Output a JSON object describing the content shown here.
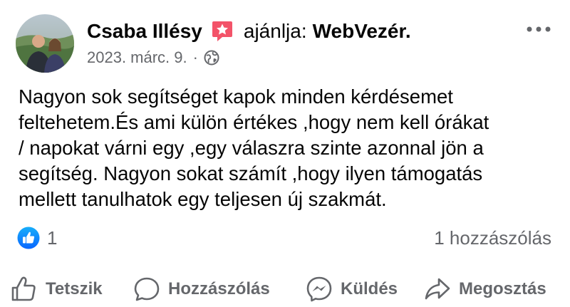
{
  "post": {
    "author": "Csaba Illésy",
    "recommends_text": "ajánlja:",
    "page_name": "WebVezér.",
    "date": "2023. márc. 9.",
    "separator": "·",
    "audience_icon": "globe-icon",
    "badge_icon": "star-badge-icon",
    "more_icon": "more-options-icon",
    "text_lines": [
      "Nagyon sok segítséget kapok minden kérdésemet",
      "feltehetem.És ami külön értékes ,hogy nem kell órákat",
      "/ napokat várni egy ,egy válaszra szinte azonnal jön a",
      "segítség. Nagyon sokat számít ,hogy ilyen támogatás",
      "mellett tanulhatok egy teljesen új szakmát."
    ]
  },
  "stats": {
    "reaction_count": "1",
    "comment_count": "1 hozzászólás"
  },
  "actions": {
    "like": "Tetszik",
    "comment": "Hozzászólás",
    "send": "Küldés",
    "share": "Megosztás"
  },
  "colors": {
    "text": "#050505",
    "secondary": "#65676b",
    "like_blue": "#1877f2",
    "badge_pink": "#f35369"
  }
}
